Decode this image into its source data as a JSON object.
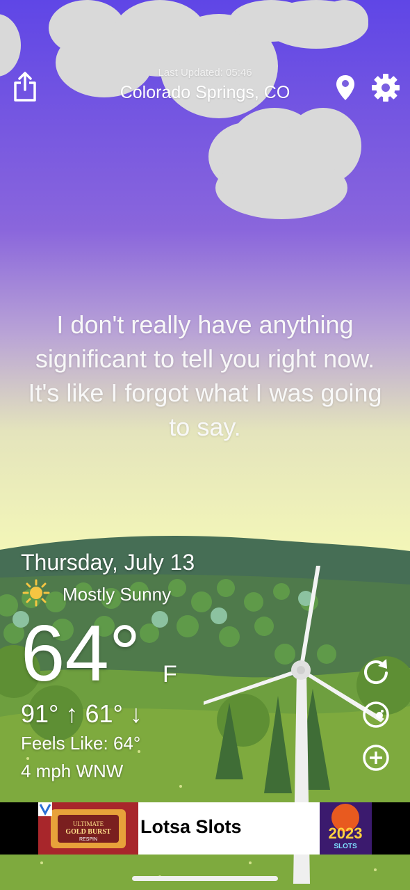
{
  "header": {
    "last_updated": "Last Updated: 05:46",
    "location": "Colorado Springs, CO",
    "share_icon": "share-icon",
    "location_icon": "location-pin-icon",
    "settings_icon": "gear-icon"
  },
  "message": "I don't really have anything significant to tell you right now. It's like I forgot what I was going to say.",
  "weather": {
    "date": "Thursday, July 13",
    "condition": "Mostly Sunny",
    "condition_icon": "sun-icon",
    "temperature": "64°",
    "unit": "F",
    "high_low": "91° ↑ 61° ↓",
    "feels_like": "Feels Like: 64°",
    "wind": "4 mph WNW"
  },
  "side_buttons": [
    "refresh-icon",
    "radar-icon",
    "add-icon"
  ],
  "ad": {
    "title": "Lotsa Slots",
    "left_image_text": "ULTIMATE GOLD BURST RESPIN",
    "right_image_text": "2023 SLOTS"
  },
  "colors": {
    "sky_top": "#5f46e6",
    "sky_bottom": "#f3f6b8",
    "grass": "#7eaa3e",
    "hills": "#466e55"
  }
}
